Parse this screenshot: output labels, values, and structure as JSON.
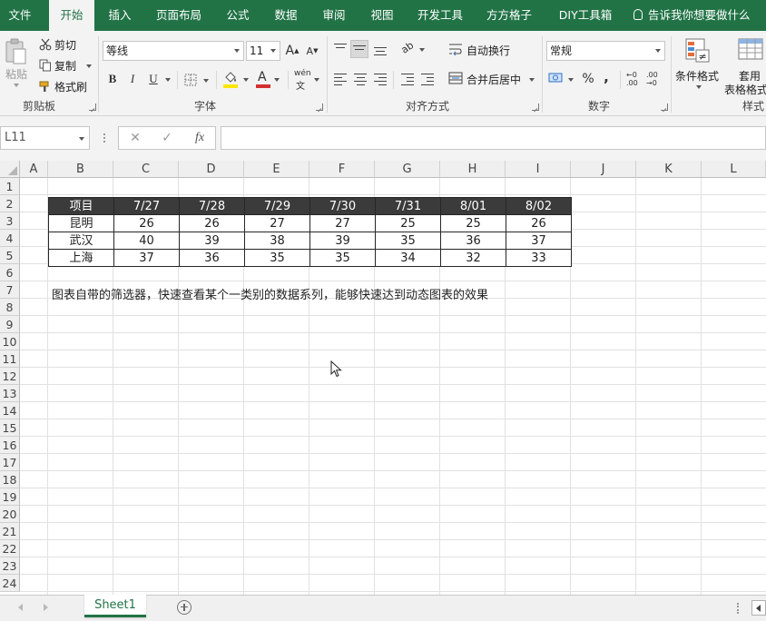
{
  "ribbon_tabs": [
    "文件",
    "开始",
    "插入",
    "页面布局",
    "公式",
    "数据",
    "审阅",
    "视图",
    "开发工具",
    "方方格子",
    "DIY工具箱"
  ],
  "active_tab": "开始",
  "tell_me": "告诉我你想要做什么",
  "clipboard": {
    "paste": "粘贴",
    "cut": "剪切",
    "copy": "复制",
    "format_painter": "格式刷",
    "label": "剪贴板"
  },
  "font": {
    "name": "等线",
    "size": "11",
    "grow": "A",
    "shrink": "A",
    "bold": "B",
    "italic": "I",
    "underline": "U",
    "font_color_letter": "A",
    "phonetic": "wén",
    "label": "字体"
  },
  "alignment": {
    "wrap_text": "自动换行",
    "merge_center": "合并后居中",
    "label": "对齐方式"
  },
  "number": {
    "format": "常规",
    "percent": "%",
    "comma": ",",
    "label": "数字"
  },
  "styles": {
    "conditional_format": "条件格式",
    "table_format_line1": "套用",
    "table_format_line2": "表格格式",
    "label": "样式"
  },
  "formula_bar": {
    "name_box": "L11",
    "fx": "fx",
    "formula": ""
  },
  "columns": [
    "A",
    "B",
    "C",
    "D",
    "E",
    "F",
    "G",
    "H",
    "I",
    "J",
    "K",
    "L"
  ],
  "rows": [
    "1",
    "2",
    "3",
    "4",
    "5",
    "6",
    "7",
    "8",
    "9",
    "10",
    "11",
    "12",
    "13",
    "14",
    "15",
    "16",
    "17",
    "18",
    "19",
    "20",
    "21",
    "22",
    "23",
    "24"
  ],
  "table": {
    "header": [
      "项目",
      "7/27",
      "7/28",
      "7/29",
      "7/30",
      "7/31",
      "8/01",
      "8/02"
    ],
    "rows": [
      [
        "昆明",
        "26",
        "26",
        "27",
        "27",
        "25",
        "25",
        "26"
      ],
      [
        "武汉",
        "40",
        "39",
        "38",
        "39",
        "35",
        "36",
        "37"
      ],
      [
        "上海",
        "37",
        "36",
        "35",
        "35",
        "34",
        "32",
        "33"
      ]
    ]
  },
  "note": "图表自带的筛选器，快速查看某个一类别的数据系列，能够快速达到动态图表的效果",
  "sheet_tab": "Sheet1",
  "colors": {
    "excel_green": "#217346",
    "table_header_bg": "#3b3b3b"
  }
}
